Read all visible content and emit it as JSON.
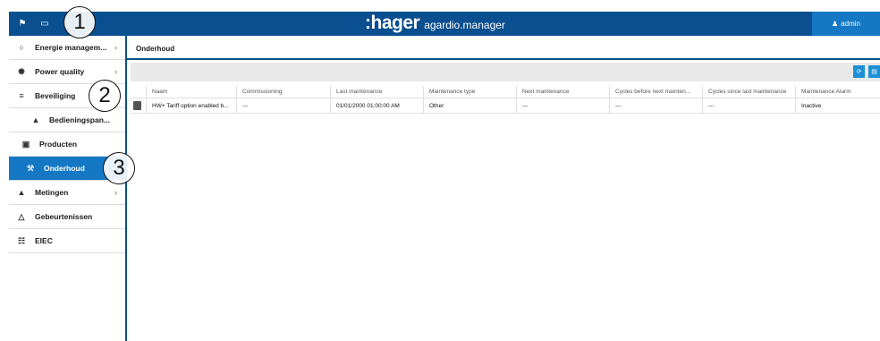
{
  "header": {
    "home_icon": "home-icon",
    "monitor_icon": "monitor-icon",
    "brand_logo": ":hager",
    "app_name": "agardio.manager",
    "user_label": "admin"
  },
  "sidebar": {
    "items": [
      {
        "label": "Energie managem...",
        "icon": "bulb-icon",
        "chevron": "›"
      },
      {
        "label": "Power quality",
        "icon": "wrench-pq-icon",
        "chevron": "›"
      },
      {
        "label": "Beveiliging",
        "icon": "sliders-icon",
        "chevron": ""
      },
      {
        "label": "Bedieningspan...",
        "icon": "chart-icon",
        "chevron": ""
      },
      {
        "label": "Producten",
        "icon": "box-icon",
        "chevron": ""
      },
      {
        "label": "Onderhoud",
        "icon": "wrench-icon",
        "chevron": ""
      },
      {
        "label": "Metingen",
        "icon": "chart-icon",
        "chevron": "›"
      },
      {
        "label": "Gebeurtenissen",
        "icon": "bell-icon",
        "chevron": ""
      },
      {
        "label": "EIEC",
        "icon": "hierarchy-icon",
        "chevron": ""
      }
    ]
  },
  "main": {
    "tab_label": "Onderhoud",
    "table": {
      "columns": [
        "Naam",
        "Commissioning",
        "Last maintenance",
        "Maintenance type",
        "Next maintenance",
        "Cycles before next mainten...",
        "Cycles since last maintenance",
        "Maintenance Alarm"
      ],
      "rows": [
        [
          "HW+ Tariff option enabled b...",
          "---",
          "01/01/2000 01:00:00 AM",
          "Other",
          "---",
          "---",
          "---",
          "Inactive"
        ]
      ]
    }
  },
  "callouts": [
    "1",
    "2",
    "3"
  ],
  "colors": {
    "topbar": "#0a4f8f",
    "accent": "#1478c4",
    "button": "#1c8fd6"
  }
}
